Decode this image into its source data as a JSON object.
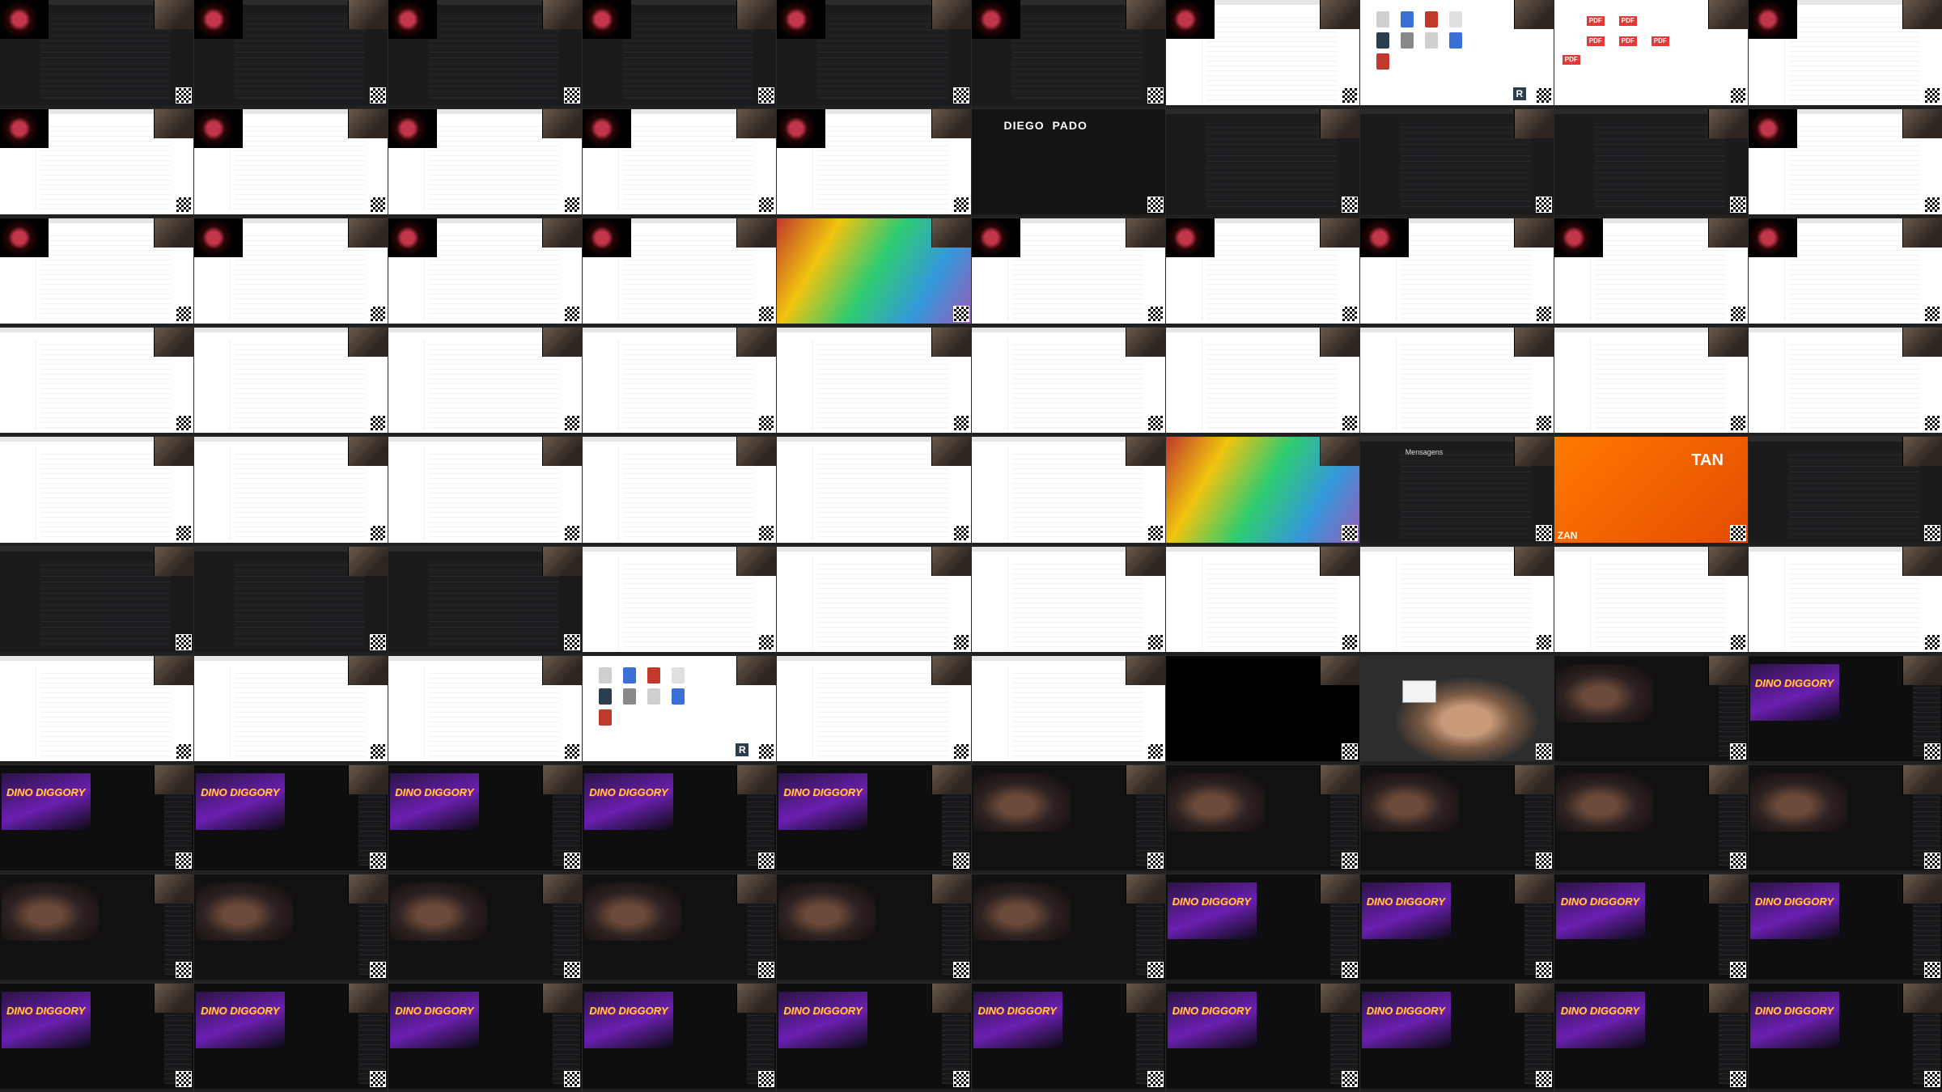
{
  "screen": {
    "description_tags": [
      "contact-sheet",
      "screen-recording-thumbnails"
    ]
  },
  "labels": {
    "pdf_badge": "PDF",
    "r_badge": "R",
    "profile_logo": "DIEGO",
    "profile_logo_2": "PADO",
    "stream_title": "DINO DIGGORY",
    "orange_text_1": "TAN",
    "orange_text_2": "ZAN",
    "messages_title": "Mensagens"
  },
  "tiles": [
    "dark",
    "dark",
    "dark",
    "darkb",
    "darkb",
    "dark",
    "white",
    "icons",
    "pdf",
    "white",
    "white",
    "white",
    "white",
    "white",
    "white",
    "profile",
    "darkgreen",
    "darkgreen",
    "darkgreen",
    "white",
    "white",
    "white",
    "white",
    "white",
    "collage",
    "white",
    "white",
    "white",
    "white",
    "white",
    "white",
    "white",
    "white",
    "white",
    "white",
    "white",
    "white",
    "white",
    "white",
    "white",
    "white",
    "white",
    "white",
    "white",
    "white",
    "white",
    "collage",
    "messages",
    "orange",
    "darkgreen",
    "darkgreen",
    "darkgreen",
    "darkgreen",
    "white",
    "white",
    "white",
    "white",
    "white",
    "white",
    "white",
    "white",
    "white",
    "white",
    "icons2",
    "white",
    "white",
    "black",
    "face",
    "room",
    "stream",
    "stream",
    "stream",
    "stream",
    "stream",
    "stream",
    "room",
    "room",
    "room",
    "room",
    "room",
    "room",
    "room",
    "room",
    "room",
    "room",
    "room",
    "stream",
    "stream",
    "stream",
    "stream",
    "stream",
    "stream",
    "stream",
    "stream",
    "stream",
    "stream",
    "stream",
    "stream",
    "stream",
    "stream"
  ]
}
